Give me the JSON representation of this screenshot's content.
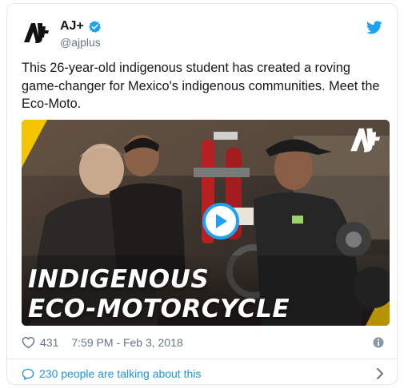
{
  "tweet": {
    "author": {
      "display_name": "AJ+",
      "handle": "@ajplus",
      "verified": true,
      "avatar_icon": "ajplus-logo-icon"
    },
    "text": "This 26-year-old indigenous student has created a roving game-changer for Mexico's indigenous communities. Meet the Eco-Moto.",
    "media": {
      "type": "video",
      "caption_line1": "INDIGENOUS",
      "caption_line2": "ECO-MOTORCYCLE",
      "play_icon": "play-icon"
    },
    "likes": "431",
    "timestamp": "7:59 PM - Feb 3, 2018",
    "conversation": "230 people are talking about this"
  },
  "colors": {
    "accent": "#1da1f2",
    "link": "#1b95e0",
    "muted": "#657786",
    "brand_yellow": "#f5c400"
  }
}
